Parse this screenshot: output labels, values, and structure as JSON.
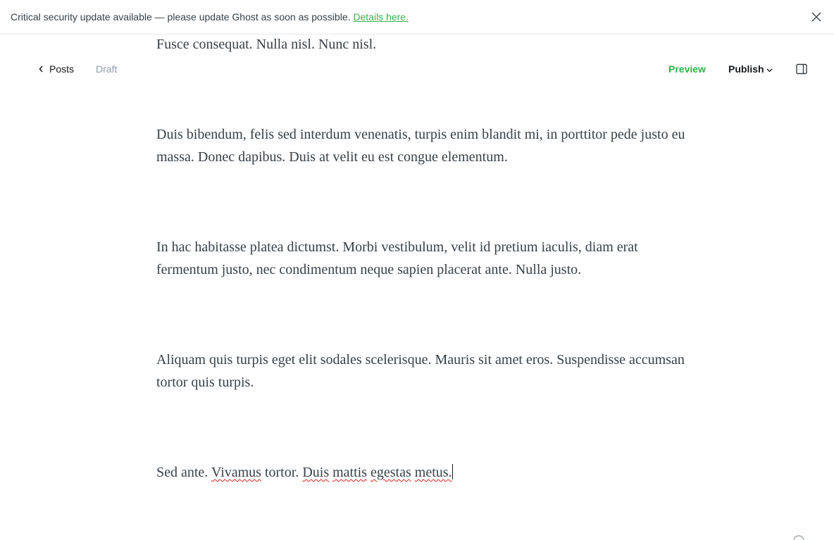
{
  "banner": {
    "message": "Critical security update available — please update Ghost as soon as possible. ",
    "link_text": "Details here.",
    "close_icon": "close-icon"
  },
  "header": {
    "back_label": "Posts",
    "back_icon": "chevron-left-icon",
    "status": "Draft",
    "preview_label": "Preview",
    "publish_label": "Publish",
    "publish_icon": "chevron-down-icon",
    "sidebar_icon": "sidebar-toggle-icon"
  },
  "editor": {
    "paragraphs": [
      "Fusce consequat. Nulla nisl. Nunc nisl.",
      "Duis bibendum, felis sed interdum venenatis, turpis enim blandit mi, in porttitor pede justo eu massa. Donec dapibus. Duis at velit eu est congue elementum.",
      "In hac habitasse platea dictumst. Morbi vestibulum, velit id pretium iaculis, diam erat fermentum justo, nec condimentum neque sapien placerat ante. Nulla justo.",
      "Aliquam quis turpis eget elit sodales scelerisque. Mauris sit amet eros. Suspendisse accumsan tortor quis turpis."
    ],
    "last_paragraph": {
      "t1": "Sed ante. ",
      "w1": "Vivamus",
      "t2": " tortor. ",
      "w2": "Duis",
      "t3": " ",
      "w3": "mattis",
      "t4": " ",
      "w4": "egestas",
      "t5": " ",
      "w5": "metus.",
      "misspelled_words": [
        "Vivamus",
        "Duis",
        "mattis",
        "egestas",
        "metus."
      ]
    }
  },
  "footer": {
    "help_icon": "help-icon"
  },
  "colors": {
    "accent_green": "#30b14b",
    "link_green": "#3eb04f",
    "muted_text": "#8e9cac",
    "body_text": "#394047",
    "spellcheck_red": "#e02020"
  }
}
